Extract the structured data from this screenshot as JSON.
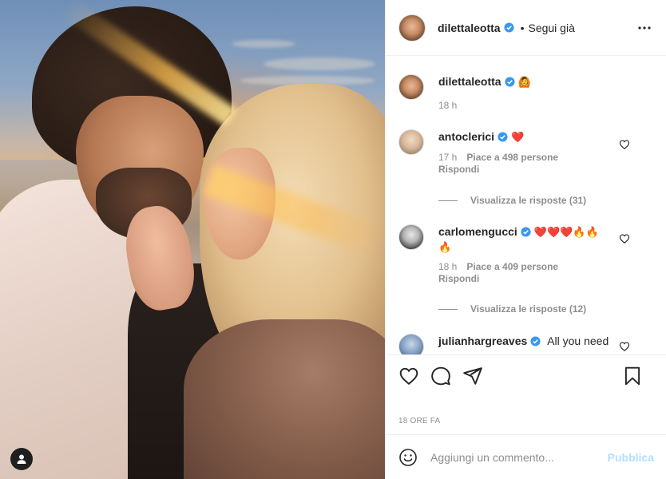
{
  "post": {
    "author": "dilettaleotta",
    "follow_status": "Segui già",
    "separator": "•",
    "caption_emoji": "🙆",
    "caption_time": "18 h",
    "timestamp": "18 ORE FA"
  },
  "comments": [
    {
      "username": "antoclerici",
      "verified": true,
      "text": "❤️",
      "time": "17 h",
      "likes": "Piace a 498 persone",
      "reply": "Rispondi",
      "view_replies": "Visualizza le risposte (31)"
    },
    {
      "username": "carlomengucci",
      "verified": true,
      "text": "❤️❤️❤️🔥🔥",
      "text_line2": "🔥",
      "time": "18 h",
      "likes": "Piace a 409 persone",
      "reply": "Rispondi",
      "view_replies": "Visualizza le risposte (12)"
    },
    {
      "username": "julianhargreaves",
      "verified": true,
      "text": "All you need"
    }
  ],
  "add_comment": {
    "placeholder": "Aggiungi un commento...",
    "publish_label": "Pubblica"
  },
  "icons": {
    "like": "heart-icon",
    "comment": "comment-icon",
    "share": "paper-plane-icon",
    "save": "bookmark-icon",
    "more": "more-horizontal-icon",
    "emoji": "smiley-icon",
    "user_tag": "user-tag-icon",
    "verified": "verified-badge-icon"
  },
  "colors": {
    "verified": "#3897f0",
    "publish_disabled": "#b2dffc",
    "heart_emoji": "#ed4956",
    "secondary_text": "#8e8e8e"
  }
}
